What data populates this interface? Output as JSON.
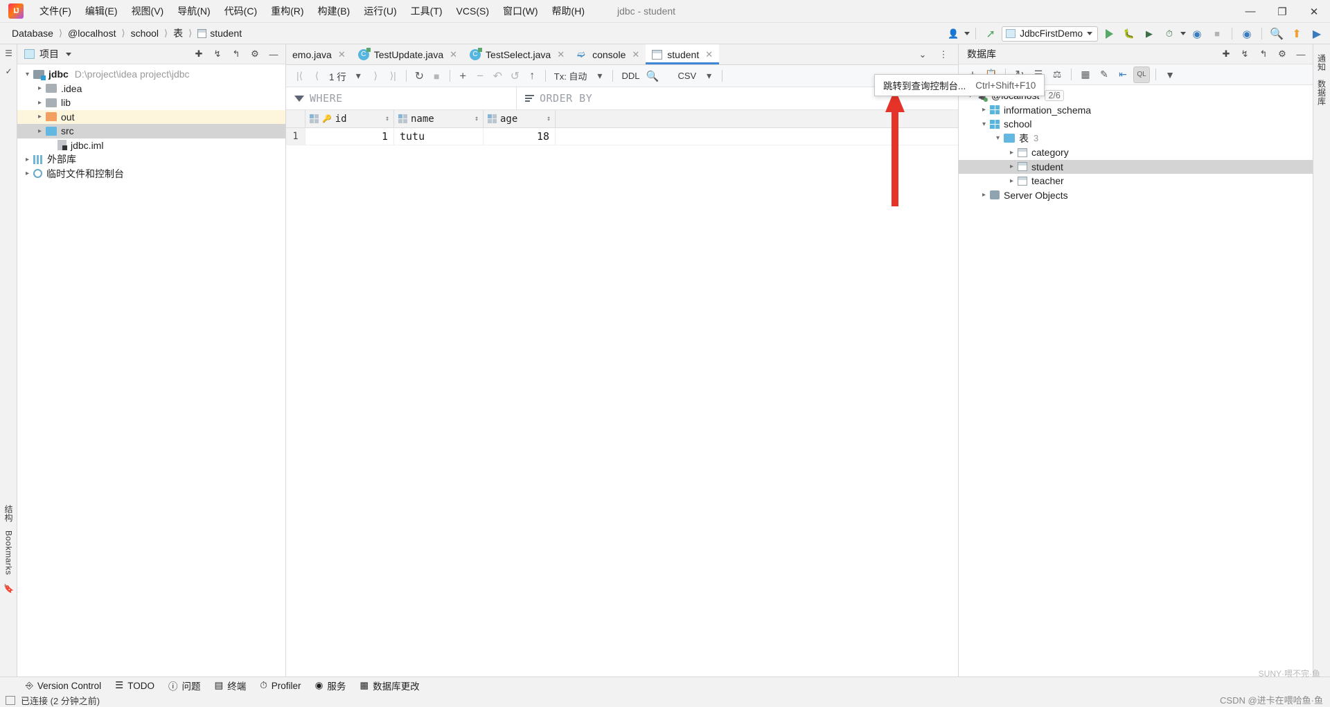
{
  "window": {
    "title": "jdbc - student",
    "minimize": "—",
    "maximize": "❐",
    "close": "✕"
  },
  "menubar": {
    "items": [
      {
        "label": "文件(F)",
        "mnemonic": "F"
      },
      {
        "label": "编辑(E)",
        "mnemonic": "E"
      },
      {
        "label": "视图(V)",
        "mnemonic": "V"
      },
      {
        "label": "导航(N)",
        "mnemonic": "N"
      },
      {
        "label": "代码(C)",
        "mnemonic": "C"
      },
      {
        "label": "重构(R)",
        "mnemonic": "R"
      },
      {
        "label": "构建(B)",
        "mnemonic": "B"
      },
      {
        "label": "运行(U)",
        "mnemonic": "U"
      },
      {
        "label": "工具(T)",
        "mnemonic": "T"
      },
      {
        "label": "VCS(S)",
        "mnemonic": "S"
      },
      {
        "label": "窗口(W)",
        "mnemonic": "W"
      },
      {
        "label": "帮助(H)",
        "mnemonic": "H"
      }
    ]
  },
  "breadcrumb": {
    "items": [
      "Database",
      "@localhost",
      "school",
      "表",
      "student"
    ],
    "separator": "⟩"
  },
  "navbar_right": {
    "run_config": "JdbcFirstDemo",
    "icons": [
      "user-icon",
      "hammer-icon",
      "run-icon",
      "debug-icon",
      "coverage-icon",
      "profile-icon",
      "stop-icon",
      "search-icon",
      "update-icon",
      "ide-icon"
    ]
  },
  "left_strip": {
    "items": [
      "结构",
      "Bookmarks"
    ]
  },
  "right_strip": {
    "items": [
      "数据库",
      "通知"
    ]
  },
  "project_panel": {
    "title": "项目",
    "tree": [
      {
        "label": "jdbc",
        "path": "D:\\project\\idea project\\jdbc",
        "icon": "module-folder-icon",
        "arrow": "open",
        "indent": 0,
        "bold": true
      },
      {
        "label": ".idea",
        "icon": "folder-gray-icon",
        "arrow": "closed",
        "indent": 1
      },
      {
        "label": "lib",
        "icon": "folder-gray-icon",
        "arrow": "closed",
        "indent": 1
      },
      {
        "label": "out",
        "icon": "folder-orange-icon",
        "arrow": "closed",
        "indent": 1,
        "state": "highlight"
      },
      {
        "label": "src",
        "icon": "folder-blue-icon",
        "arrow": "closed",
        "indent": 1,
        "state": "selected"
      },
      {
        "label": "jdbc.iml",
        "icon": "iml-file-icon",
        "arrow": "none",
        "indent": 2
      },
      {
        "label": "外部库",
        "icon": "library-icon",
        "arrow": "closed",
        "indent": 0
      },
      {
        "label": "临时文件和控制台",
        "icon": "scratches-icon",
        "arrow": "closed",
        "indent": 0
      }
    ]
  },
  "editor": {
    "tabs": [
      {
        "label": "emo.java",
        "icon": "java-class-icon",
        "active": false,
        "clipped": true
      },
      {
        "label": "TestUpdate.java",
        "icon": "java-class-icon",
        "active": false
      },
      {
        "label": "TestSelect.java",
        "icon": "java-class-icon",
        "active": false
      },
      {
        "label": "console",
        "icon": "console-icon",
        "active": false
      },
      {
        "label": "student",
        "icon": "table-icon",
        "active": true
      }
    ],
    "tab_overflow": "⌄",
    "tab_menu": "⋮"
  },
  "grid_toolbar": {
    "first_page": "|⟨",
    "prev_page": "⟨",
    "row_count": "1 行",
    "next_page": "⟩",
    "last_page": "⟩|",
    "refresh": "↻",
    "stop": "■",
    "add_row": "+",
    "delete_row": "−",
    "revert": "↶",
    "revert_selected": "↺",
    "submit": "↑",
    "tx_label": "Tx: 自动",
    "ddl": "DDL",
    "search": "search-icon",
    "export_format": "CSV",
    "more": "»"
  },
  "filters": {
    "where_placeholder": "WHERE",
    "order_by_placeholder": "ORDER BY"
  },
  "table": {
    "columns": [
      {
        "name": "id",
        "key": true
      },
      {
        "name": "name",
        "key": false
      },
      {
        "name": "age",
        "key": false
      }
    ],
    "rows": [
      {
        "index": "1",
        "id": "1",
        "name": "tutu",
        "age": "18"
      }
    ]
  },
  "database_panel": {
    "title": "数据库",
    "toolbar_icons": [
      "add-icon",
      "copy-icon",
      "refresh-icon",
      "run-query-icon",
      "sync-icon",
      "table-editor-icon",
      "edit-icon",
      "jump-icon",
      "query-console-icon",
      "filter-icon"
    ],
    "tree": [
      {
        "label": "@localhost",
        "icon": "datasource-icon",
        "arrow": "open",
        "indent": 0,
        "badge": "2/6"
      },
      {
        "label": "information_schema",
        "icon": "schema-icon",
        "arrow": "closed",
        "indent": 1
      },
      {
        "label": "school",
        "icon": "schema-icon",
        "arrow": "open",
        "indent": 1
      },
      {
        "label": "表",
        "icon": "folder-blue-icon",
        "arrow": "open",
        "indent": 2,
        "count": "3"
      },
      {
        "label": "category",
        "icon": "table-icon",
        "arrow": "closed",
        "indent": 3
      },
      {
        "label": "student",
        "icon": "table-icon",
        "arrow": "closed",
        "indent": 3,
        "state": "selected"
      },
      {
        "label": "teacher",
        "icon": "table-icon",
        "arrow": "closed",
        "indent": 3
      },
      {
        "label": "Server Objects",
        "icon": "server-objects-icon",
        "arrow": "closed",
        "indent": 1
      }
    ]
  },
  "tooltip": {
    "text": "跳转到查询控制台...",
    "shortcut": "Ctrl+Shift+F10",
    "accent_color": "#e03131"
  },
  "bottom_bar": {
    "items": [
      {
        "label": "Version Control",
        "icon": "branch-icon"
      },
      {
        "label": "TODO",
        "icon": "list-icon"
      },
      {
        "label": "问题",
        "icon": "warning-icon"
      },
      {
        "label": "终端",
        "icon": "terminal-icon"
      },
      {
        "label": "Profiler",
        "icon": "profiler-icon"
      },
      {
        "label": "服务",
        "icon": "services-icon"
      },
      {
        "label": "数据库更改",
        "icon": "db-changes-icon"
      }
    ]
  },
  "status_bar": {
    "text": "已连接 (2 分钟之前)"
  },
  "watermark": {
    "text": "CSDN @进卡在喂哈鱼·鱼",
    "sticker_text": "SUNY·喂不完·鱼"
  }
}
